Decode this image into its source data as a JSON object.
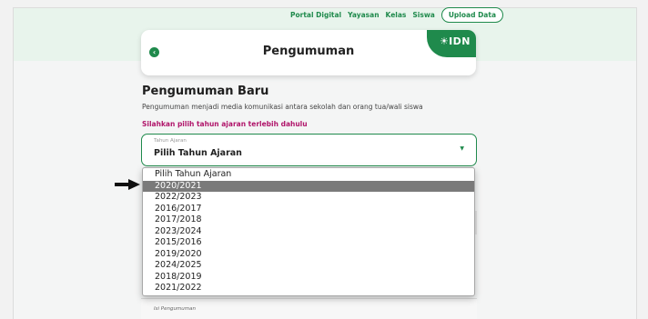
{
  "nav": {
    "items": [
      "Portal Digital",
      "Yayasan",
      "Kelas",
      "Siswa"
    ],
    "upload_label": "Upload Data"
  },
  "header": {
    "title": "Pengumuman",
    "badge_text": "IDN",
    "back_icon": "chevron-left-icon"
  },
  "section": {
    "title": "Pengumuman Baru",
    "subtitle": "Pengumuman menjadi media komunikasi antara sekolah dan orang tua/wali siswa",
    "hint": "Silahkan pilih tahun ajaran terlebih dahulu"
  },
  "select": {
    "label": "Tahun Ajaran",
    "value": "Pilih Tahun Ajaran",
    "options": [
      "Pilih Tahun Ajaran",
      "2020/2021",
      "2022/2023",
      "2016/2017",
      "2017/2018",
      "2023/2024",
      "2015/2016",
      "2019/2020",
      "2024/2025",
      "2018/2019",
      "2021/2022"
    ],
    "highlighted": "2020/2021"
  },
  "below": {
    "isi_label": "Isi Pengumuman"
  },
  "colors": {
    "brand_green": "#1f8a4c",
    "hint_magenta": "#b0156a",
    "highlight_gray": "#7a7a7a"
  }
}
